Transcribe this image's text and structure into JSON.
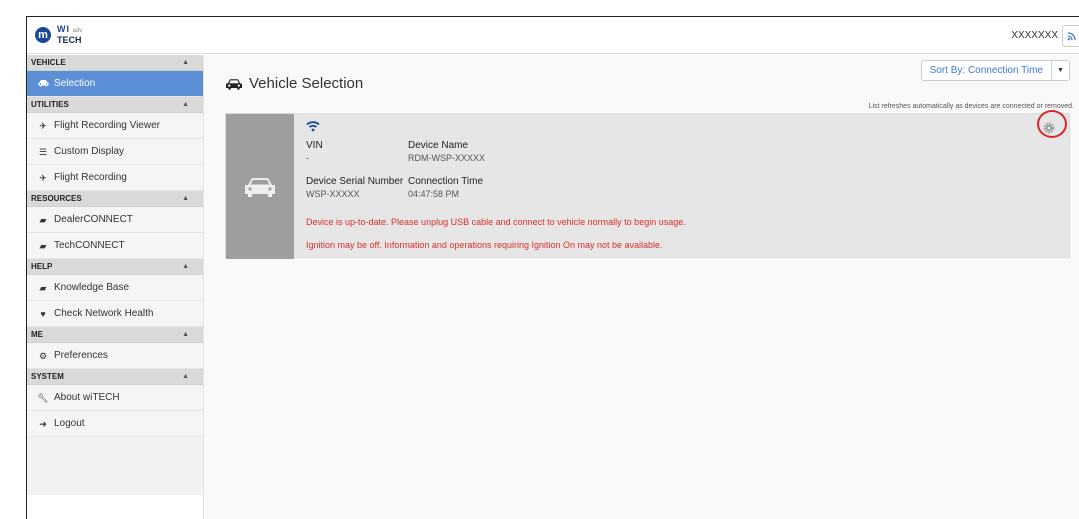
{
  "header": {
    "logo_mopar": "m",
    "logo_wi": "WI",
    "logo_tech": "TECH",
    "logo_tm": "adv",
    "user_name": "XXXXXXX",
    "rss_icon": "rss-icon"
  },
  "sidebar": {
    "sections": [
      {
        "title": "VEHICLE",
        "items": [
          {
            "label": "Selection",
            "icon": "car-icon",
            "active": true
          }
        ]
      },
      {
        "title": "UTILITIES",
        "items": [
          {
            "label": "Flight Recording Viewer",
            "icon": "plane-icon"
          },
          {
            "label": "Custom Display",
            "icon": "list-icon"
          },
          {
            "label": "Flight Recording",
            "icon": "plane-icon"
          }
        ]
      },
      {
        "title": "RESOURCES",
        "items": [
          {
            "label": "DealerCONNECT",
            "icon": "book-icon"
          },
          {
            "label": "TechCONNECT",
            "icon": "book-icon"
          }
        ]
      },
      {
        "title": "HELP",
        "items": [
          {
            "label": "Knowledge Base",
            "icon": "book-icon"
          },
          {
            "label": "Check Network Health",
            "icon": "heartbeat-icon"
          }
        ]
      },
      {
        "title": "ME",
        "items": [
          {
            "label": "Preferences",
            "icon": "preferences-icon"
          }
        ]
      },
      {
        "title": "SYSTEM",
        "items": [
          {
            "label": "About wiTECH",
            "icon": "wrench-icon"
          },
          {
            "label": "Logout",
            "icon": "logout-icon"
          }
        ]
      }
    ]
  },
  "main": {
    "title": "Vehicle Selection",
    "sort_label": "Sort By: Connection Time",
    "refresh_note": "List refreshes automatically as devices are connected or removed.",
    "device": {
      "vin_label": "VIN",
      "vin_value": "-",
      "device_name_label": "Device Name",
      "device_name_value": "RDM-WSP-XXXXX",
      "serial_label": "Device Serial Number",
      "serial_value": "WSP-XXXXX",
      "connection_time_label": "Connection Time",
      "connection_time_value": "04:47:58 PM",
      "warning_1": "Device is up-to-date. Please unplug USB cable and connect to vehicle normally to begin usage.",
      "warning_2": "Ignition may be off. Information and operations requiring Ignition On may not be available."
    }
  },
  "colors": {
    "accent": "#5b8fd6",
    "link": "#3a7bd5",
    "warning": "#d9302c",
    "highlight_ring": "#e0242b"
  }
}
